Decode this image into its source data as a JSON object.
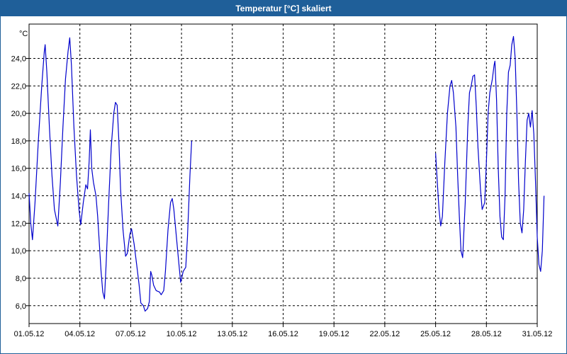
{
  "window": {
    "title": "Temperatur [°C] skaliert"
  },
  "chart_data": {
    "type": "line",
    "title": "Temperatur [°C] skaliert",
    "ylabel": "°C",
    "xlabel": "",
    "ylim": [
      4.7,
      26.5
    ],
    "xlim": [
      0,
      30
    ],
    "grid": true,
    "yticks": [
      6,
      8,
      10,
      12,
      14,
      16,
      18,
      20,
      22,
      24
    ],
    "ytick_labels": [
      "6,0",
      "8,0",
      "10,0",
      "12,0",
      "14,0",
      "16,0",
      "18,0",
      "20,0",
      "22,0",
      "24,0"
    ],
    "xticks": [
      0,
      3,
      6,
      9,
      12,
      15,
      18,
      21,
      24,
      27,
      30
    ],
    "xtick_labels": [
      "01.05.12",
      "04.05.12",
      "07.05.12",
      "10.05.12",
      "13.05.12",
      "16.05.12",
      "19.05.12",
      "22.05.12",
      "25.05.12",
      "28.05.12",
      "31.05.12"
    ],
    "series_color": "#0000cc",
    "series": [
      {
        "name": "",
        "segments": [
          [
            [
              0.0,
              14.2
            ],
            [
              0.1,
              12.0
            ],
            [
              0.2,
              10.8
            ],
            [
              0.35,
              13.5
            ],
            [
              0.55,
              18.0
            ],
            [
              0.75,
              22.0
            ],
            [
              0.9,
              24.5
            ],
            [
              0.95,
              25.0
            ],
            [
              1.05,
              23.0
            ],
            [
              1.2,
              19.0
            ],
            [
              1.35,
              15.5
            ],
            [
              1.5,
              13.0
            ],
            [
              1.7,
              11.8
            ],
            [
              1.85,
              15.0
            ],
            [
              2.0,
              19.0
            ],
            [
              2.15,
              22.5
            ],
            [
              2.3,
              24.5
            ],
            [
              2.4,
              25.5
            ],
            [
              2.5,
              23.5
            ],
            [
              2.65,
              19.0
            ],
            [
              2.8,
              15.5
            ],
            [
              2.95,
              13.0
            ],
            [
              3.05,
              11.9
            ],
            [
              3.2,
              13.5
            ],
            [
              3.35,
              14.8
            ],
            [
              3.45,
              14.5
            ],
            [
              3.55,
              16.5
            ],
            [
              3.62,
              18.8
            ],
            [
              3.7,
              16.0
            ],
            [
              3.8,
              15.0
            ],
            [
              3.95,
              14.0
            ],
            [
              4.05,
              12.5
            ],
            [
              4.15,
              10.5
            ],
            [
              4.25,
              8.5
            ],
            [
              4.35,
              7.0
            ],
            [
              4.45,
              6.5
            ],
            [
              4.55,
              9.0
            ],
            [
              4.7,
              13.5
            ],
            [
              4.85,
              17.5
            ],
            [
              5.0,
              20.0
            ],
            [
              5.1,
              20.8
            ],
            [
              5.2,
              20.6
            ],
            [
              5.3,
              18.0
            ],
            [
              5.4,
              14.5
            ],
            [
              5.55,
              11.5
            ],
            [
              5.7,
              9.6
            ],
            [
              5.8,
              9.8
            ],
            [
              5.95,
              11.2
            ],
            [
              6.05,
              11.6
            ],
            [
              6.2,
              10.5
            ],
            [
              6.35,
              9.0
            ],
            [
              6.5,
              7.5
            ],
            [
              6.6,
              6.2
            ],
            [
              6.75,
              6.0
            ],
            [
              6.85,
              5.6
            ],
            [
              7.0,
              5.8
            ],
            [
              7.1,
              6.3
            ],
            [
              7.18,
              8.5
            ],
            [
              7.25,
              8.2
            ],
            [
              7.35,
              7.5
            ],
            [
              7.5,
              7.1
            ],
            [
              7.7,
              7.0
            ],
            [
              7.8,
              6.8
            ],
            [
              7.95,
              7.1
            ],
            [
              8.05,
              8.5
            ],
            [
              8.2,
              11.5
            ],
            [
              8.35,
              13.5
            ],
            [
              8.45,
              13.8
            ],
            [
              8.55,
              13.0
            ],
            [
              8.7,
              11.0
            ],
            [
              8.85,
              9.0
            ],
            [
              8.95,
              7.7
            ],
            [
              9.1,
              8.5
            ],
            [
              9.25,
              8.8
            ],
            [
              9.35,
              11.0
            ],
            [
              9.5,
              15.5
            ],
            [
              9.6,
              18.0
            ]
          ],
          [
            [
              24.0,
              17.1
            ],
            [
              24.1,
              15.0
            ],
            [
              24.2,
              13.0
            ],
            [
              24.3,
              11.8
            ],
            [
              24.4,
              12.5
            ],
            [
              24.55,
              16.5
            ],
            [
              24.7,
              20.0
            ],
            [
              24.85,
              22.0
            ],
            [
              24.95,
              22.4
            ],
            [
              25.05,
              21.5
            ],
            [
              25.2,
              19.0
            ],
            [
              25.3,
              15.5
            ],
            [
              25.4,
              12.5
            ],
            [
              25.5,
              10.0
            ],
            [
              25.6,
              9.5
            ],
            [
              25.75,
              13.5
            ],
            [
              25.9,
              19.0
            ],
            [
              26.0,
              21.5
            ],
            [
              26.1,
              22.0
            ],
            [
              26.2,
              22.7
            ],
            [
              26.3,
              22.8
            ],
            [
              26.4,
              20.5
            ],
            [
              26.5,
              17.5
            ],
            [
              26.65,
              14.5
            ],
            [
              26.75,
              13.0
            ],
            [
              26.9,
              13.5
            ],
            [
              27.0,
              16.5
            ],
            [
              27.1,
              20.0
            ],
            [
              27.2,
              21.5
            ],
            [
              27.35,
              22.5
            ],
            [
              27.45,
              23.5
            ],
            [
              27.5,
              23.8
            ],
            [
              27.6,
              21.0
            ],
            [
              27.7,
              16.0
            ],
            [
              27.8,
              12.5
            ],
            [
              27.9,
              11.0
            ],
            [
              28.0,
              10.8
            ],
            [
              28.1,
              14.0
            ],
            [
              28.2,
              20.0
            ],
            [
              28.3,
              23.0
            ],
            [
              28.4,
              23.5
            ],
            [
              28.5,
              25.0
            ],
            [
              28.6,
              25.6
            ],
            [
              28.7,
              24.0
            ],
            [
              28.8,
              20.0
            ],
            [
              28.9,
              15.0
            ],
            [
              29.0,
              12.0
            ],
            [
              29.1,
              11.3
            ],
            [
              29.2,
              13.0
            ],
            [
              29.3,
              16.5
            ],
            [
              29.4,
              19.5
            ],
            [
              29.5,
              20.0
            ],
            [
              29.6,
              19.0
            ],
            [
              29.7,
              20.2
            ],
            [
              29.8,
              18.5
            ],
            [
              29.9,
              15.0
            ],
            [
              30.0,
              11.0
            ],
            [
              30.1,
              9.0
            ],
            [
              30.2,
              8.5
            ],
            [
              30.3,
              10.0
            ],
            [
              30.4,
              14.0
            ]
          ]
        ]
      }
    ]
  }
}
